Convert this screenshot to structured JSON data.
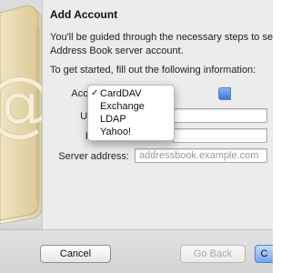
{
  "dialog": {
    "title": "Add Account",
    "description_lines": [
      "You'll be guided through the necessary steps to set",
      "Address Book server account."
    ],
    "start_text": "To get started, fill out the following information:"
  },
  "form": {
    "account_type_label": "Account type",
    "user_name_label": "User name",
    "password_label": "Password",
    "server_address_label": "Server address:",
    "server_address_placeholder": "addressbook.example.com"
  },
  "menu": {
    "items": [
      {
        "label": "CardDAV",
        "checked": true,
        "check": "✓"
      },
      {
        "label": "Exchange",
        "checked": false
      },
      {
        "label": "LDAP",
        "checked": false
      },
      {
        "label": "Yahoo!",
        "checked": false
      }
    ]
  },
  "buttons": {
    "cancel": "Cancel",
    "go_back": "Go Back",
    "continue": "C"
  },
  "artwork": {
    "icon": "address-book-at-icon"
  },
  "colors": {
    "accent": "#3a78d9",
    "book": "#e8dcb8"
  }
}
